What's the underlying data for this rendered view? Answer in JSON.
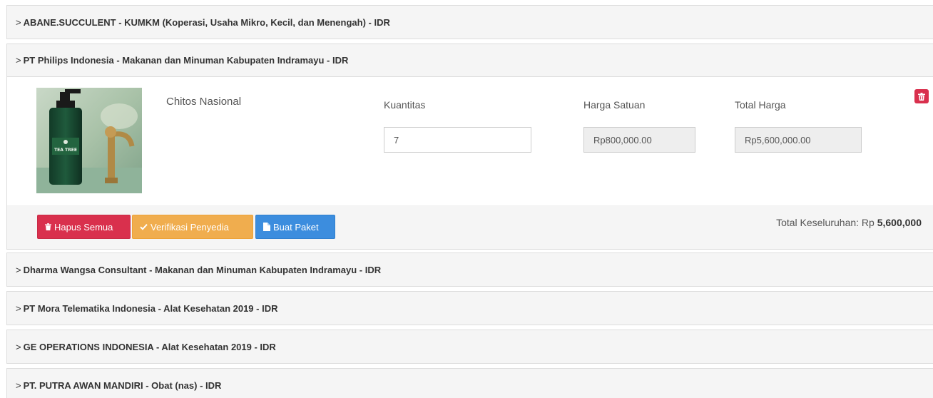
{
  "vendors": [
    {
      "title": "ABANE.SUCCULENT - KUMKM (Koperasi, Usaha Mikro, Kecil, dan Menengah) - IDR"
    },
    {
      "title": "PT Philips Indonesia - Makanan dan Minuman Kabupaten Indramayu - IDR"
    },
    {
      "title": "Dharma Wangsa Consultant - Makanan dan Minuman Kabupaten Indramayu - IDR"
    },
    {
      "title": "PT Mora Telematika Indonesia - Alat Kesehatan 2019 - IDR"
    },
    {
      "title": "GE OPERATIONS INDONESIA - Alat Kesehatan 2019 - IDR"
    },
    {
      "title": "PT. PUTRA AWAN MANDIRI - Obat (nas) - IDR"
    }
  ],
  "chevron": ">",
  "cart_item": {
    "name": "Chitos Nasional",
    "image_label": "TEA TREE",
    "quantity_label": "Kuantitas",
    "quantity_value": "7",
    "unit_price_label": "Harga Satuan",
    "unit_price_value": "Rp800,000.00",
    "total_price_label": "Total Harga",
    "total_price_value": "Rp5,600,000.00",
    "delete_icon": "trash-icon"
  },
  "footer": {
    "delete_all_label": "Hapus Semua",
    "verify_label": "Verifikasi Penyedia",
    "create_package_label": "Buat Paket",
    "grand_total_label": "Total Keseluruhan: Rp ",
    "grand_total_value": "5,600,000"
  },
  "colors": {
    "danger": "#d9304d",
    "warning": "#f0ad4e",
    "primary": "#3c8dde",
    "panel_bg": "#f5f5f5"
  }
}
